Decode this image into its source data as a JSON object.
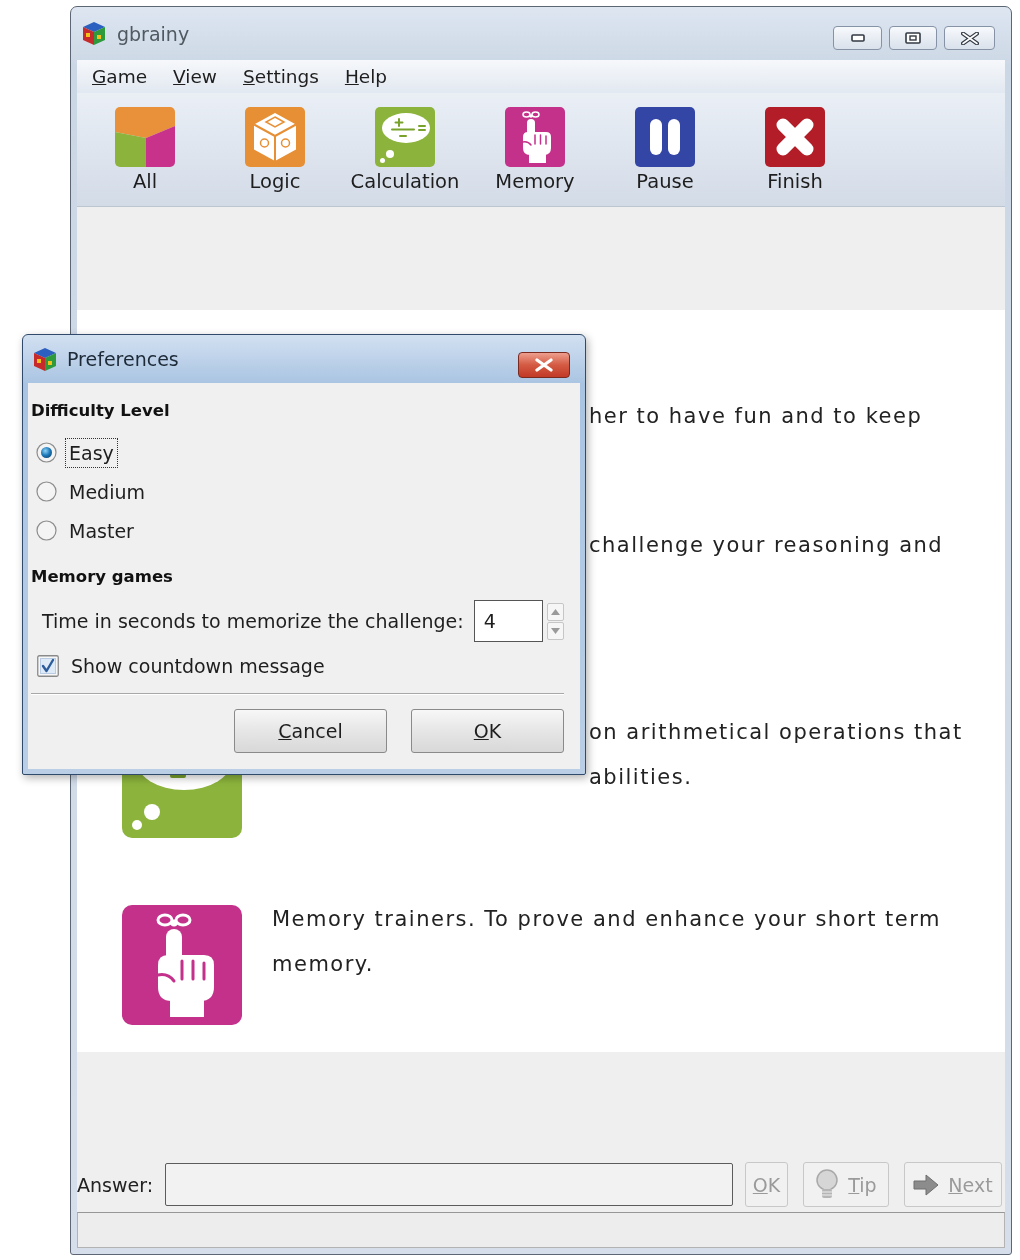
{
  "window": {
    "title": "gbrainy"
  },
  "menu": [
    "Game",
    "View",
    "Settings",
    "Help"
  ],
  "toolbar": [
    {
      "kind": "all",
      "label": "All"
    },
    {
      "kind": "logic",
      "label": "Logic"
    },
    {
      "kind": "calculation",
      "label": "Calculation"
    },
    {
      "kind": "memory",
      "label": "Memory"
    },
    {
      "kind": "pause",
      "label": "Pause"
    },
    {
      "kind": "finish",
      "label": "Finish"
    }
  ],
  "descriptions": [
    {
      "kind": "hidden",
      "lines": [
        "her to have fun and to keep"
      ]
    },
    {
      "kind": "hidden",
      "lines": [
        "challenge your reasoning and"
      ]
    },
    {
      "kind": "calculation",
      "lines": [
        "on arithmetical operations that",
        "abilities."
      ]
    },
    {
      "kind": "memory",
      "lines": [
        "Memory trainers. To prove and enhance your short term memory."
      ]
    }
  ],
  "answer_bar": {
    "label": "Answer:",
    "buttons": [
      {
        "kind": "ok",
        "label": "OK",
        "disabled": true
      },
      {
        "kind": "tip",
        "label": "Tip",
        "disabled": true
      },
      {
        "kind": "next",
        "label": "Next",
        "disabled": true
      }
    ]
  },
  "preferences_dialog": {
    "title": "Preferences",
    "difficulty_heading": "Difficulty Level",
    "difficulty_options": [
      {
        "label": "Easy",
        "selected": true,
        "focused": true
      },
      {
        "label": "Medium",
        "selected": false,
        "focused": false
      },
      {
        "label": "Master",
        "selected": false,
        "focused": false
      }
    ],
    "memory_heading": "Memory games",
    "time_label": "Time in seconds to memorize the challenge:",
    "time_value": "4",
    "countdown": {
      "label": "Show countdown message",
      "checked": true
    },
    "buttons": [
      "Cancel",
      "OK"
    ]
  }
}
